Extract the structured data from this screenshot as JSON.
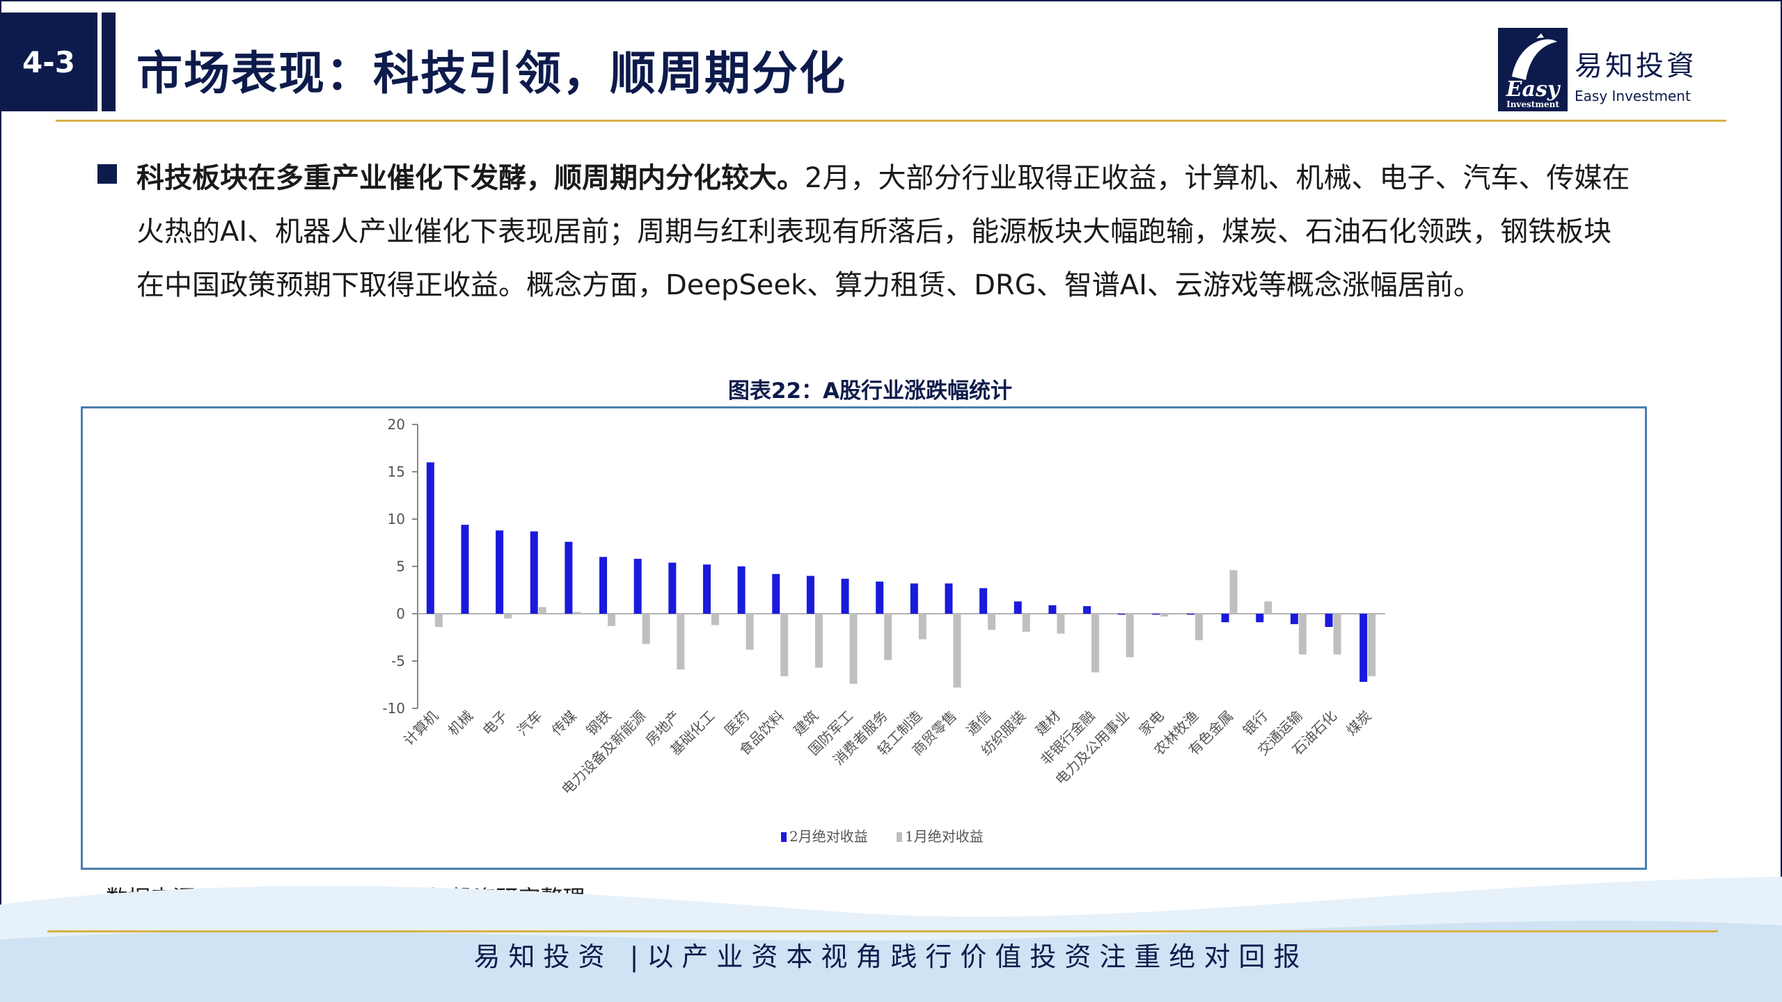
{
  "header": {
    "section_number": "4-3",
    "title": "市场表现：科技引领，顺周期分化",
    "logo_cn": "易知投資",
    "logo_en": "Easy Investment",
    "logo_mark_text": "Easy"
  },
  "body": {
    "bold_lead": "科技板块在多重产业催化下发酵，顺周期内分化较大。",
    "paragraph": "2月，大部分行业取得正收益，计算机、机械、电子、汽车、传媒在火热的AI、机器人产业催化下表现居前；周期与红利表现有所落后，能源板块大幅跑输，煤炭、石油石化领跌，钢铁板块在中国政策预期下取得正收益。概念方面，DeepSeek、算力租赁、DRG、智谱AI、云游戏等概念涨幅居前。"
  },
  "chart_title": "图表22：A股行业涨跌幅统计",
  "source": "数据来源：Wind、华福证券、易知投资研究整理",
  "footer": {
    "slogan": "易知投资 |以产业资本视角践行价值投资注重绝对回报"
  },
  "colors": {
    "navy": "#0d1b4c",
    "gold": "#d8b04a",
    "series_feb": "#1a1adc",
    "series_jan": "#bfbfbf",
    "chart_border": "#4b7fae"
  },
  "chart_data": {
    "type": "bar",
    "categories": [
      "计算机",
      "机械",
      "电子",
      "汽车",
      "传媒",
      "钢铁",
      "电力设备及新能源",
      "房地产",
      "基础化工",
      "医药",
      "食品饮料",
      "建筑",
      "国防军工",
      "消费者服务",
      "轻工制造",
      "商贸零售",
      "通信",
      "纺织服装",
      "建材",
      "非银行金融",
      "电力及公用事业",
      "家电",
      "农林牧渔",
      "有色金属",
      "银行",
      "交通运输",
      "石油石化",
      "煤炭"
    ],
    "series": [
      {
        "name": "2月绝对收益",
        "values": [
          16.0,
          9.4,
          8.8,
          8.7,
          7.6,
          6.0,
          5.8,
          5.4,
          5.2,
          5.0,
          4.2,
          4.0,
          3.7,
          3.4,
          3.2,
          3.2,
          2.7,
          1.3,
          0.9,
          0.8,
          -0.1,
          -0.1,
          -0.1,
          -0.9,
          -0.9,
          -1.1,
          -1.4,
          -7.2
        ]
      },
      {
        "name": "1月绝对收益",
        "values": [
          -1.4,
          -0.1,
          -0.5,
          0.7,
          0.2,
          -1.3,
          -3.2,
          -5.9,
          -1.2,
          -3.8,
          -6.6,
          -5.7,
          -7.4,
          -4.9,
          -2.7,
          -7.8,
          -1.7,
          -1.9,
          -2.1,
          -6.2,
          -4.6,
          -0.3,
          -2.8,
          4.6,
          1.3,
          -4.3,
          -4.3,
          -6.6
        ]
      }
    ],
    "ylim": [
      -10,
      20
    ],
    "yticks": [
      20,
      15,
      10,
      5,
      0,
      -5,
      -10
    ],
    "legend_position": "bottom-center",
    "grid": false
  }
}
